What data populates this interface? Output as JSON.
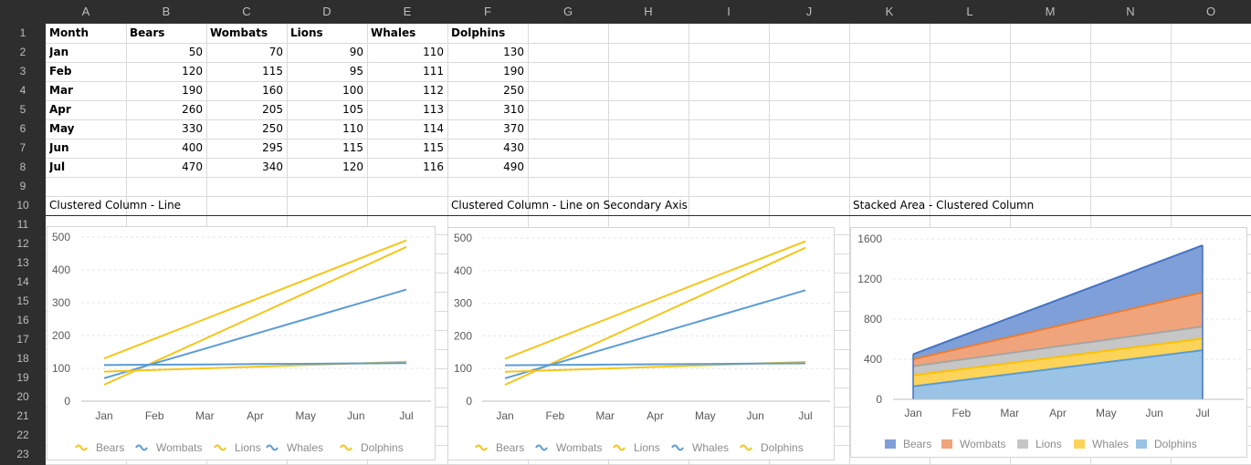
{
  "columns": [
    "A",
    "B",
    "C",
    "D",
    "E",
    "F",
    "G",
    "H",
    "I",
    "J",
    "K",
    "L",
    "M",
    "N",
    "O"
  ],
  "rows": [
    "1",
    "2",
    "3",
    "4",
    "5",
    "6",
    "7",
    "8",
    "9",
    "10",
    "11",
    "12",
    "13",
    "14",
    "15",
    "16",
    "17",
    "18",
    "19",
    "20",
    "21",
    "22",
    "23"
  ],
  "table": {
    "header": [
      "Month",
      "Bears",
      "Wombats",
      "Lions",
      "Whales",
      "Dolphins"
    ],
    "rows": [
      [
        "Jan",
        "50",
        "70",
        "90",
        "110",
        "130"
      ],
      [
        "Feb",
        "120",
        "115",
        "95",
        "111",
        "190"
      ],
      [
        "Mar",
        "190",
        "160",
        "100",
        "112",
        "250"
      ],
      [
        "Apr",
        "260",
        "205",
        "105",
        "113",
        "310"
      ],
      [
        "May",
        "330",
        "250",
        "110",
        "114",
        "370"
      ],
      [
        "Jun",
        "400",
        "295",
        "115",
        "115",
        "430"
      ],
      [
        "Jul",
        "470",
        "340",
        "120",
        "116",
        "490"
      ]
    ]
  },
  "labels": {
    "chart1": "Clustered Column - Line",
    "chart2": "Clustered Column - Line on Secondary Axis",
    "chart3": "Stacked Area - Clustered Column"
  },
  "colors": {
    "gold": "#f5c518",
    "blue": "#5b9bd5",
    "area_bears": "#7f9fd8",
    "area_wombats": "#f0a47c",
    "area_lions": "#c6c6c6",
    "area_whales": "#fcd45a",
    "area_dolphins": "#9ac3e6"
  },
  "chart_data": [
    {
      "type": "line",
      "categories": [
        "Jan",
        "Feb",
        "Mar",
        "Apr",
        "May",
        "Jun",
        "Jul"
      ],
      "ylim": [
        0,
        500
      ],
      "yticks": [
        "0",
        "100",
        "200",
        "300",
        "400",
        "500"
      ],
      "legend": "bottom",
      "series": [
        {
          "name": "Bears",
          "values": [
            50,
            120,
            190,
            260,
            330,
            400,
            470
          ]
        },
        {
          "name": "Wombats",
          "values": [
            70,
            115,
            160,
            205,
            250,
            295,
            340
          ]
        },
        {
          "name": "Lions",
          "values": [
            90,
            95,
            100,
            105,
            110,
            115,
            120
          ]
        },
        {
          "name": "Whales",
          "values": [
            110,
            111,
            112,
            113,
            114,
            115,
            116
          ]
        },
        {
          "name": "Dolphins",
          "values": [
            130,
            190,
            250,
            310,
            370,
            430,
            490
          ]
        }
      ]
    },
    {
      "type": "line",
      "categories": [
        "Jan",
        "Feb",
        "Mar",
        "Apr",
        "May",
        "Jun",
        "Jul"
      ],
      "ylim": [
        0,
        500
      ],
      "yticks": [
        "0",
        "100",
        "200",
        "300",
        "400",
        "500"
      ],
      "legend": "bottom",
      "series": [
        {
          "name": "Bears",
          "values": [
            50,
            120,
            190,
            260,
            330,
            400,
            470
          ]
        },
        {
          "name": "Wombats",
          "values": [
            70,
            115,
            160,
            205,
            250,
            295,
            340
          ]
        },
        {
          "name": "Lions",
          "values": [
            90,
            95,
            100,
            105,
            110,
            115,
            120
          ]
        },
        {
          "name": "Whales",
          "values": [
            110,
            111,
            112,
            113,
            114,
            115,
            116
          ]
        },
        {
          "name": "Dolphins",
          "values": [
            130,
            190,
            250,
            310,
            370,
            430,
            490
          ]
        }
      ]
    },
    {
      "type": "area",
      "stacked": true,
      "categories": [
        "Jan",
        "Feb",
        "Mar",
        "Apr",
        "May",
        "Jun",
        "Jul"
      ],
      "ylim": [
        0,
        1600
      ],
      "yticks": [
        "0",
        "400",
        "800",
        "1200",
        "1600"
      ],
      "legend": "bottom",
      "series": [
        {
          "name": "Bears",
          "values": [
            50,
            120,
            190,
            260,
            330,
            400,
            470
          ]
        },
        {
          "name": "Wombats",
          "values": [
            70,
            115,
            160,
            205,
            250,
            295,
            340
          ]
        },
        {
          "name": "Lions",
          "values": [
            90,
            95,
            100,
            105,
            110,
            115,
            120
          ]
        },
        {
          "name": "Whales",
          "values": [
            110,
            111,
            112,
            113,
            114,
            115,
            116
          ]
        },
        {
          "name": "Dolphins",
          "values": [
            130,
            190,
            250,
            310,
            370,
            430,
            490
          ]
        }
      ]
    }
  ]
}
